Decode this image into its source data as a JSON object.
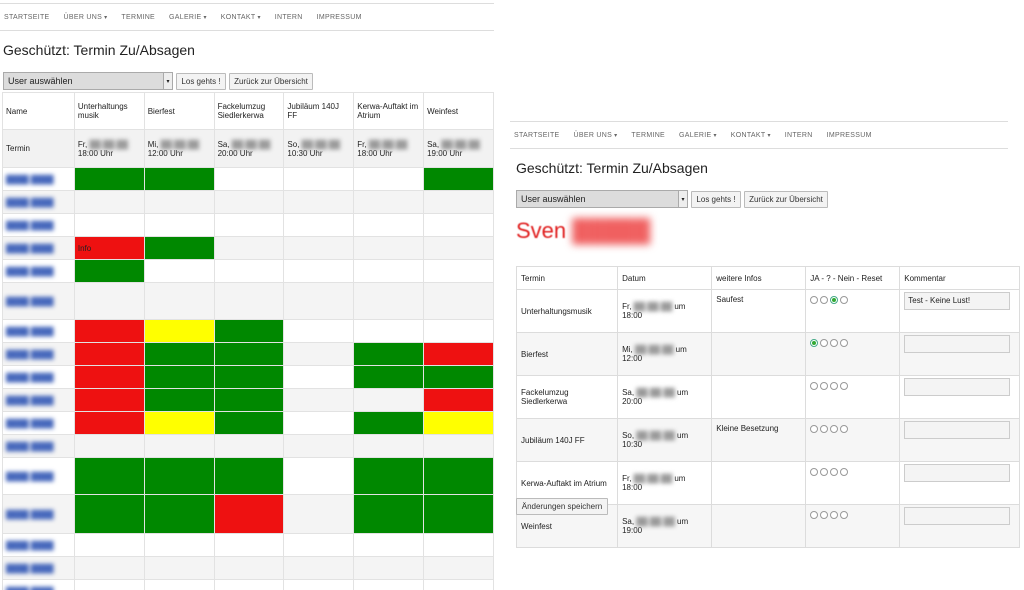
{
  "nav": [
    "STARTSEITE",
    "ÜBER UNS",
    "TERMINE",
    "GALERIE",
    "KONTAKT",
    "INTERN",
    "IMPRESSUM"
  ],
  "title": "Geschützt: Termin Zu/Absagen",
  "select_label": "User auswählen",
  "go_button": "Los gehts !",
  "back_button": "Zurück zur Übersicht",
  "grid": {
    "name_header": "Name",
    "termin_label": "Termin",
    "events": [
      {
        "name": "Unterhaltungs musik",
        "day": "Fr,",
        "time": "18:00 Uhr"
      },
      {
        "name": "Bierfest",
        "day": "Mi,",
        "time": "12:00 Uhr"
      },
      {
        "name": "Fackelumzug Siedlerkerwa",
        "day": "Sa,",
        "time": "20:00 Uhr"
      },
      {
        "name": "Jubiläum 140J FF",
        "day": "So,",
        "time": "10:30 Uhr"
      },
      {
        "name": "Kerwa-Auftakt im Atrium",
        "day": "Fr,",
        "time": "18:00 Uhr"
      },
      {
        "name": "Weinfest",
        "day": "Sa,",
        "time": "19:00 Uhr"
      }
    ],
    "info_text": "Info",
    "rows": [
      [
        "g",
        "g",
        "",
        "",
        "",
        "g"
      ],
      [
        "",
        "",
        "",
        "",
        "",
        ""
      ],
      [
        "",
        "",
        "",
        "",
        "",
        ""
      ],
      [
        "r",
        "g",
        "",
        "",
        "",
        ""
      ],
      [
        "g",
        "",
        "",
        "",
        "",
        ""
      ],
      [
        "",
        "",
        "",
        "",
        "",
        ""
      ],
      [
        "r",
        "y",
        "g",
        "",
        "",
        ""
      ],
      [
        "r",
        "g",
        "g",
        "",
        "g",
        "r"
      ],
      [
        "r",
        "g",
        "g",
        "",
        "g",
        "g"
      ],
      [
        "r",
        "g",
        "g",
        "",
        "",
        "r"
      ],
      [
        "r",
        "y",
        "g",
        "",
        "g",
        "y"
      ],
      [
        "",
        "",
        "",
        "",
        "",
        ""
      ],
      [
        "g",
        "g",
        "g",
        "",
        "g",
        "g"
      ],
      [
        "g",
        "g",
        "r",
        "",
        "g",
        "g"
      ],
      [
        "",
        "",
        "",
        "",
        "",
        ""
      ],
      [
        "",
        "",
        "",
        "",
        "",
        ""
      ],
      [
        "",
        "",
        "",
        "",
        "",
        ""
      ]
    ]
  },
  "detail": {
    "user_first_name": "Sven",
    "headers": [
      "Termin",
      "Datum",
      "weitere Infos",
      "JA - ? - Nein - Reset",
      "Kommentar"
    ],
    "rows": [
      {
        "termin": "Unterhaltungsmusik",
        "day": "Fr,",
        "time": "um 18:00",
        "info": "Saufest",
        "sel": 2,
        "comment": "Test - Keine Lust!"
      },
      {
        "termin": "Bierfest",
        "day": "Mi,",
        "time": "um 12:00",
        "info": "",
        "sel": 0,
        "comment": ""
      },
      {
        "termin": "Fackelumzug Siedlerkerwa",
        "day": "Sa,",
        "time": "um 20:00",
        "info": "",
        "sel": -1,
        "comment": ""
      },
      {
        "termin": "Jubiläum 140J FF",
        "day": "So,",
        "time": "um 10:30",
        "info": "Kleine Besetzung",
        "sel": -1,
        "comment": ""
      },
      {
        "termin": "Kerwa-Auftakt im Atrium",
        "day": "Fr,",
        "time": "um 18:00",
        "info": "",
        "sel": -1,
        "comment": ""
      },
      {
        "termin": "Weinfest",
        "day": "Sa,",
        "time": "um 19:00",
        "info": "",
        "sel": -1,
        "comment": ""
      }
    ],
    "save_button": "Änderungen speichern"
  }
}
